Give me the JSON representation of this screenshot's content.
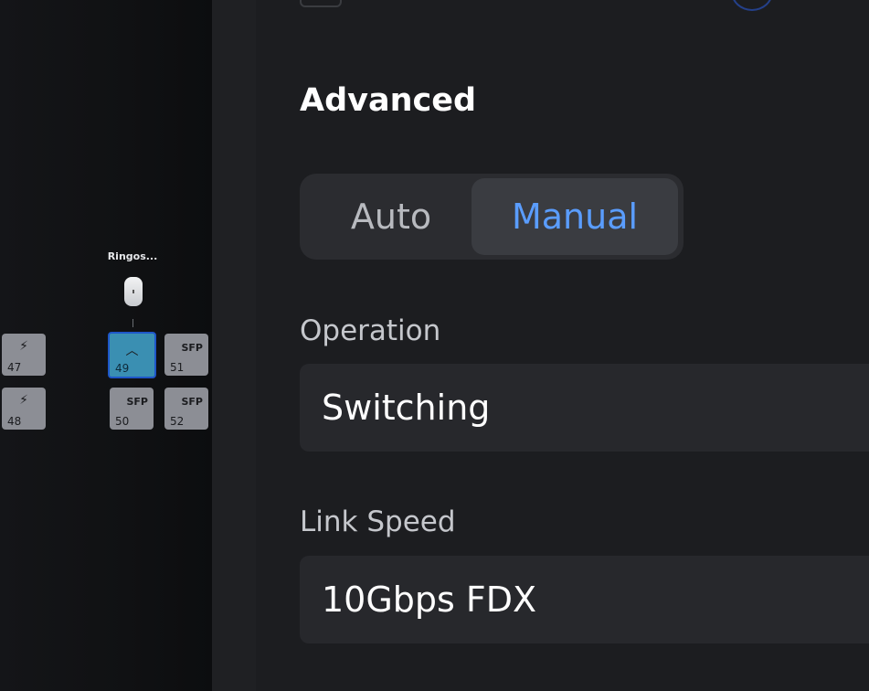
{
  "topology": {
    "device_label": "Ringos...",
    "ports": [
      {
        "number": "47",
        "type": "poe",
        "icon": "poe-icon"
      },
      {
        "number": "48",
        "type": "poe",
        "icon": "poe-icon"
      },
      {
        "number": "49",
        "type": "uplink",
        "icon": "chevron-up-icon",
        "selected": true
      },
      {
        "number": "50",
        "type": "sfp",
        "tag": "SFP"
      },
      {
        "number": "51",
        "type": "sfp",
        "tag": "SFP"
      },
      {
        "number": "52",
        "type": "sfp",
        "tag": "SFP"
      }
    ],
    "colors": {
      "port": "#8c8e95",
      "port_selected": "#3a8fb2",
      "port_selected_border": "#1e56c8"
    }
  },
  "panel": {
    "section_title": "Advanced",
    "mode_toggle": {
      "options": [
        "Auto",
        "Manual"
      ],
      "selected": "Manual"
    },
    "operation": {
      "label": "Operation",
      "value": "Switching"
    },
    "link_speed": {
      "label": "Link Speed",
      "value": "10Gbps FDX"
    },
    "colors": {
      "accent": "#5a9dff",
      "background": "#1c1d20",
      "field": "#27282c"
    }
  }
}
